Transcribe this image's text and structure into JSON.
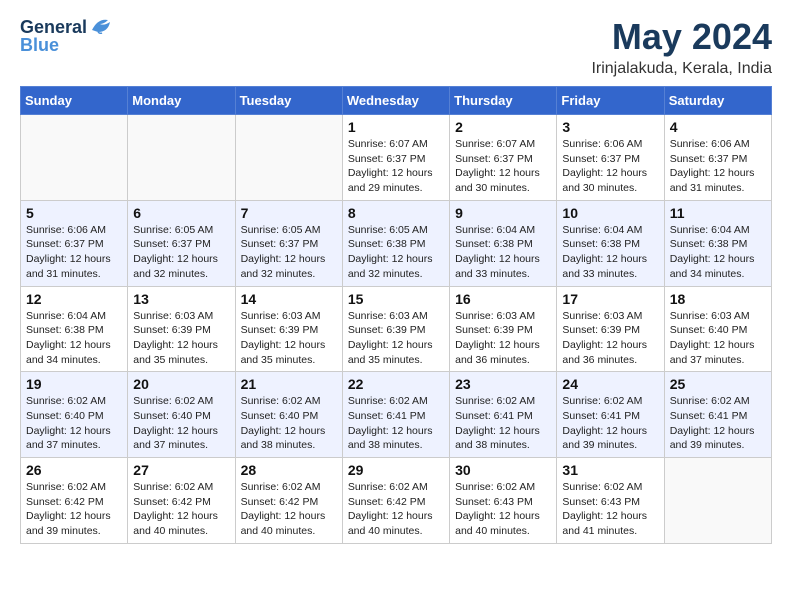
{
  "header": {
    "logo_line1": "General",
    "logo_line2": "Blue",
    "title": "May 2024",
    "location": "Irinjalakuda, Kerala, India"
  },
  "weekdays": [
    "Sunday",
    "Monday",
    "Tuesday",
    "Wednesday",
    "Thursday",
    "Friday",
    "Saturday"
  ],
  "weeks": [
    [
      {
        "day": "",
        "info": ""
      },
      {
        "day": "",
        "info": ""
      },
      {
        "day": "",
        "info": ""
      },
      {
        "day": "1",
        "info": "Sunrise: 6:07 AM\nSunset: 6:37 PM\nDaylight: 12 hours and 29 minutes."
      },
      {
        "day": "2",
        "info": "Sunrise: 6:07 AM\nSunset: 6:37 PM\nDaylight: 12 hours and 30 minutes."
      },
      {
        "day": "3",
        "info": "Sunrise: 6:06 AM\nSunset: 6:37 PM\nDaylight: 12 hours and 30 minutes."
      },
      {
        "day": "4",
        "info": "Sunrise: 6:06 AM\nSunset: 6:37 PM\nDaylight: 12 hours and 31 minutes."
      }
    ],
    [
      {
        "day": "5",
        "info": "Sunrise: 6:06 AM\nSunset: 6:37 PM\nDaylight: 12 hours and 31 minutes."
      },
      {
        "day": "6",
        "info": "Sunrise: 6:05 AM\nSunset: 6:37 PM\nDaylight: 12 hours and 32 minutes."
      },
      {
        "day": "7",
        "info": "Sunrise: 6:05 AM\nSunset: 6:37 PM\nDaylight: 12 hours and 32 minutes."
      },
      {
        "day": "8",
        "info": "Sunrise: 6:05 AM\nSunset: 6:38 PM\nDaylight: 12 hours and 32 minutes."
      },
      {
        "day": "9",
        "info": "Sunrise: 6:04 AM\nSunset: 6:38 PM\nDaylight: 12 hours and 33 minutes."
      },
      {
        "day": "10",
        "info": "Sunrise: 6:04 AM\nSunset: 6:38 PM\nDaylight: 12 hours and 33 minutes."
      },
      {
        "day": "11",
        "info": "Sunrise: 6:04 AM\nSunset: 6:38 PM\nDaylight: 12 hours and 34 minutes."
      }
    ],
    [
      {
        "day": "12",
        "info": "Sunrise: 6:04 AM\nSunset: 6:38 PM\nDaylight: 12 hours and 34 minutes."
      },
      {
        "day": "13",
        "info": "Sunrise: 6:03 AM\nSunset: 6:39 PM\nDaylight: 12 hours and 35 minutes."
      },
      {
        "day": "14",
        "info": "Sunrise: 6:03 AM\nSunset: 6:39 PM\nDaylight: 12 hours and 35 minutes."
      },
      {
        "day": "15",
        "info": "Sunrise: 6:03 AM\nSunset: 6:39 PM\nDaylight: 12 hours and 35 minutes."
      },
      {
        "day": "16",
        "info": "Sunrise: 6:03 AM\nSunset: 6:39 PM\nDaylight: 12 hours and 36 minutes."
      },
      {
        "day": "17",
        "info": "Sunrise: 6:03 AM\nSunset: 6:39 PM\nDaylight: 12 hours and 36 minutes."
      },
      {
        "day": "18",
        "info": "Sunrise: 6:03 AM\nSunset: 6:40 PM\nDaylight: 12 hours and 37 minutes."
      }
    ],
    [
      {
        "day": "19",
        "info": "Sunrise: 6:02 AM\nSunset: 6:40 PM\nDaylight: 12 hours and 37 minutes."
      },
      {
        "day": "20",
        "info": "Sunrise: 6:02 AM\nSunset: 6:40 PM\nDaylight: 12 hours and 37 minutes."
      },
      {
        "day": "21",
        "info": "Sunrise: 6:02 AM\nSunset: 6:40 PM\nDaylight: 12 hours and 38 minutes."
      },
      {
        "day": "22",
        "info": "Sunrise: 6:02 AM\nSunset: 6:41 PM\nDaylight: 12 hours and 38 minutes."
      },
      {
        "day": "23",
        "info": "Sunrise: 6:02 AM\nSunset: 6:41 PM\nDaylight: 12 hours and 38 minutes."
      },
      {
        "day": "24",
        "info": "Sunrise: 6:02 AM\nSunset: 6:41 PM\nDaylight: 12 hours and 39 minutes."
      },
      {
        "day": "25",
        "info": "Sunrise: 6:02 AM\nSunset: 6:41 PM\nDaylight: 12 hours and 39 minutes."
      }
    ],
    [
      {
        "day": "26",
        "info": "Sunrise: 6:02 AM\nSunset: 6:42 PM\nDaylight: 12 hours and 39 minutes."
      },
      {
        "day": "27",
        "info": "Sunrise: 6:02 AM\nSunset: 6:42 PM\nDaylight: 12 hours and 40 minutes."
      },
      {
        "day": "28",
        "info": "Sunrise: 6:02 AM\nSunset: 6:42 PM\nDaylight: 12 hours and 40 minutes."
      },
      {
        "day": "29",
        "info": "Sunrise: 6:02 AM\nSunset: 6:42 PM\nDaylight: 12 hours and 40 minutes."
      },
      {
        "day": "30",
        "info": "Sunrise: 6:02 AM\nSunset: 6:43 PM\nDaylight: 12 hours and 40 minutes."
      },
      {
        "day": "31",
        "info": "Sunrise: 6:02 AM\nSunset: 6:43 PM\nDaylight: 12 hours and 41 minutes."
      },
      {
        "day": "",
        "info": ""
      }
    ]
  ]
}
